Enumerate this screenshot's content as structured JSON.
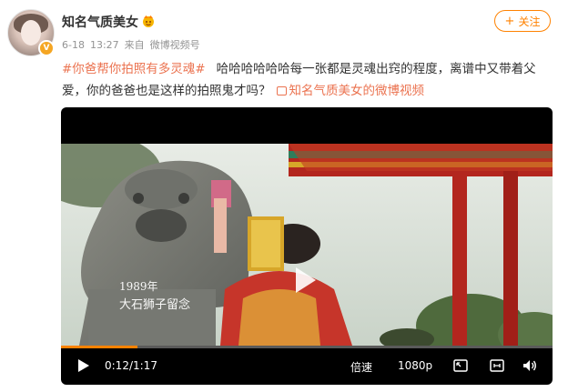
{
  "post": {
    "username": "知名气质美女",
    "verified_badge": "V",
    "date": "6-18",
    "time": "13:27",
    "source_prefix": "来自",
    "source": "微博视频号",
    "follow_label": "关注",
    "topic": "#你爸帮你拍照有多灵魂#",
    "text": "哈哈哈哈哈哈每一张都是灵魂出窍的程度，离谱中又带着父爱，你的爸爸也是这样的拍照鬼才吗？",
    "video_link_label": "知名气质美女的微博视频"
  },
  "player": {
    "current_time": "0:12",
    "duration": "1:17",
    "progress_fraction": 0.156,
    "quality_label": "倍速",
    "resolution_label": "1080p",
    "caption_year": "1989年",
    "caption_text": "大石狮子留念"
  },
  "colors": {
    "accent_orange": "#ff8200",
    "link_color": "#eb7350",
    "meta_gray": "#939393"
  },
  "icons": [
    "vip-crown-icon",
    "plus-icon",
    "video-link-icon",
    "play-icon",
    "center-play-icon",
    "pip-icon",
    "widescreen-icon",
    "volume-icon"
  ]
}
